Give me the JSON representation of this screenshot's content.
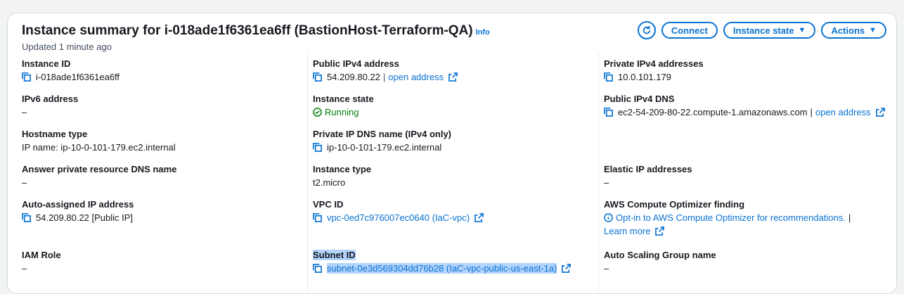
{
  "header": {
    "title": "Instance summary for i-018ade1f6361ea6ff (BastionHost-Terraform-QA)",
    "info_label": "Info",
    "updated": "Updated 1 minute ago",
    "connect_label": "Connect",
    "instance_state_label": "Instance state",
    "actions_label": "Actions"
  },
  "col1": {
    "instance_id_label": "Instance ID",
    "instance_id": "i-018ade1f6361ea6ff",
    "ipv6_label": "IPv6 address",
    "ipv6": "–",
    "hostname_type_label": "Hostname type",
    "hostname_type": "IP name: ip-10-0-101-179.ec2.internal",
    "answer_dns_label": "Answer private resource DNS name",
    "answer_dns": "–",
    "auto_ip_label": "Auto-assigned IP address",
    "auto_ip": "54.209.80.22 [Public IP]",
    "iam_label": "IAM Role",
    "iam": "–"
  },
  "col2": {
    "public_ipv4_label": "Public IPv4 address",
    "public_ipv4": "54.209.80.22",
    "open_address": "open address",
    "state_label": "Instance state",
    "state": "Running",
    "private_dns_label": "Private IP DNS name (IPv4 only)",
    "private_dns": "ip-10-0-101-179.ec2.internal",
    "type_label": "Instance type",
    "type": "t2.micro",
    "vpc_label": "VPC ID",
    "vpc": "vpc-0ed7c976007ec0640 (IaC-vpc)",
    "subnet_label": "Subnet ID",
    "subnet": "subnet-0e3d569304dd76b28 (IaC-vpc-public-us-east-1a)"
  },
  "col3": {
    "private_ipv4_label": "Private IPv4 addresses",
    "private_ipv4": "10.0.101.179",
    "public_dns_label": "Public IPv4 DNS",
    "public_dns": "ec2-54-209-80-22.compute-1.amazonaws.com",
    "open_address": "open address",
    "elastic_label": "Elastic IP addresses",
    "elastic": "–",
    "optimizer_label": "AWS Compute Optimizer finding",
    "optimizer_link": "Opt-in to AWS Compute Optimizer for recommendations.",
    "learn_more": "Learn more",
    "asg_label": "Auto Scaling Group name",
    "asg": "–"
  }
}
